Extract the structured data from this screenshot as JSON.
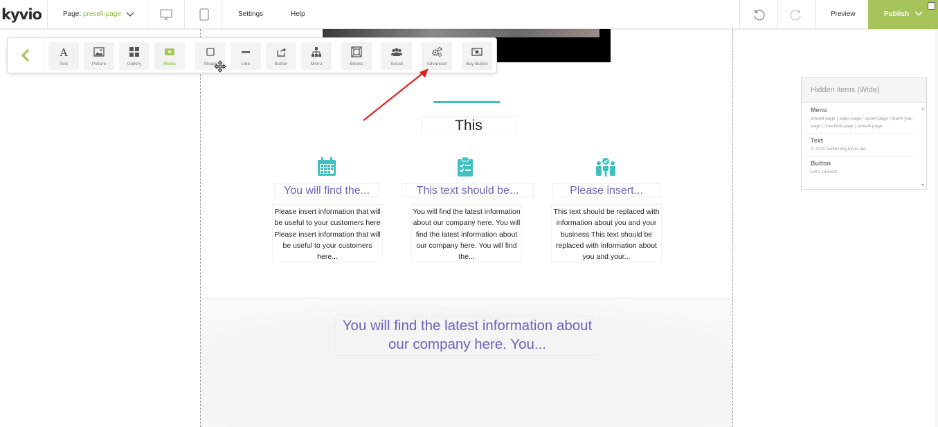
{
  "topbar": {
    "logo": "kyvio",
    "page_label": "Page:",
    "page_name": "presell-page",
    "menu": {
      "settings": "Settings",
      "help": "Help"
    },
    "preview": "Preview",
    "publish": "Publish"
  },
  "widgets": [
    {
      "label": "Text",
      "icon": "text-icon"
    },
    {
      "label": "Picture",
      "icon": "picture-icon"
    },
    {
      "label": "Gallery",
      "icon": "gallery-icon"
    },
    {
      "label": "Media",
      "icon": "media-icon"
    },
    {
      "label": "Shape",
      "icon": "shape-icon"
    },
    {
      "label": "Line",
      "icon": "line-icon"
    },
    {
      "label": "Button",
      "icon": "button-icon"
    },
    {
      "label": "Menu",
      "icon": "menu-icon"
    },
    {
      "label": "Blocks",
      "icon": "blocks-icon"
    },
    {
      "label": "Social",
      "icon": "social-icon"
    },
    {
      "label": "Advanced",
      "icon": "advanced-icon"
    },
    {
      "label": "Buy Button",
      "icon": "buy-button-icon"
    }
  ],
  "content": {
    "title": "This",
    "features": [
      {
        "icon": "calendar-icon",
        "title": "You will find the...",
        "body": "Please insert information that will be useful to your customers here Please insert information that will be useful to your customers here..."
      },
      {
        "icon": "clipboard-checklist-icon",
        "title": "This text should be...",
        "body": "You will find the latest information about our company here. You will find the latest information about our company here. You will find the..."
      },
      {
        "icon": "team-icon",
        "title": "Please insert...",
        "body": "This text should be replaced with information about you and your business This text should be replaced with information about you and your..."
      }
    ],
    "big_text": "You will find the latest information about our company here. You..."
  },
  "hidden_panel": {
    "title": "Hidden items (Wide)",
    "rows": [
      {
        "title": "Menu",
        "sub": "presell-page | sales-page | upsell-page | thank-you-page | checkout-page | presell-page"
      },
      {
        "title": "Text",
        "sub": "© 2020 heiltesting.kyvio.net"
      },
      {
        "title": "Button",
        "sub": "Let's connect"
      }
    ]
  },
  "colors": {
    "accent": "#a6c45a",
    "teal": "#40c0bf",
    "purple_text": "#6b63b8",
    "arrow": "#e02020"
  }
}
